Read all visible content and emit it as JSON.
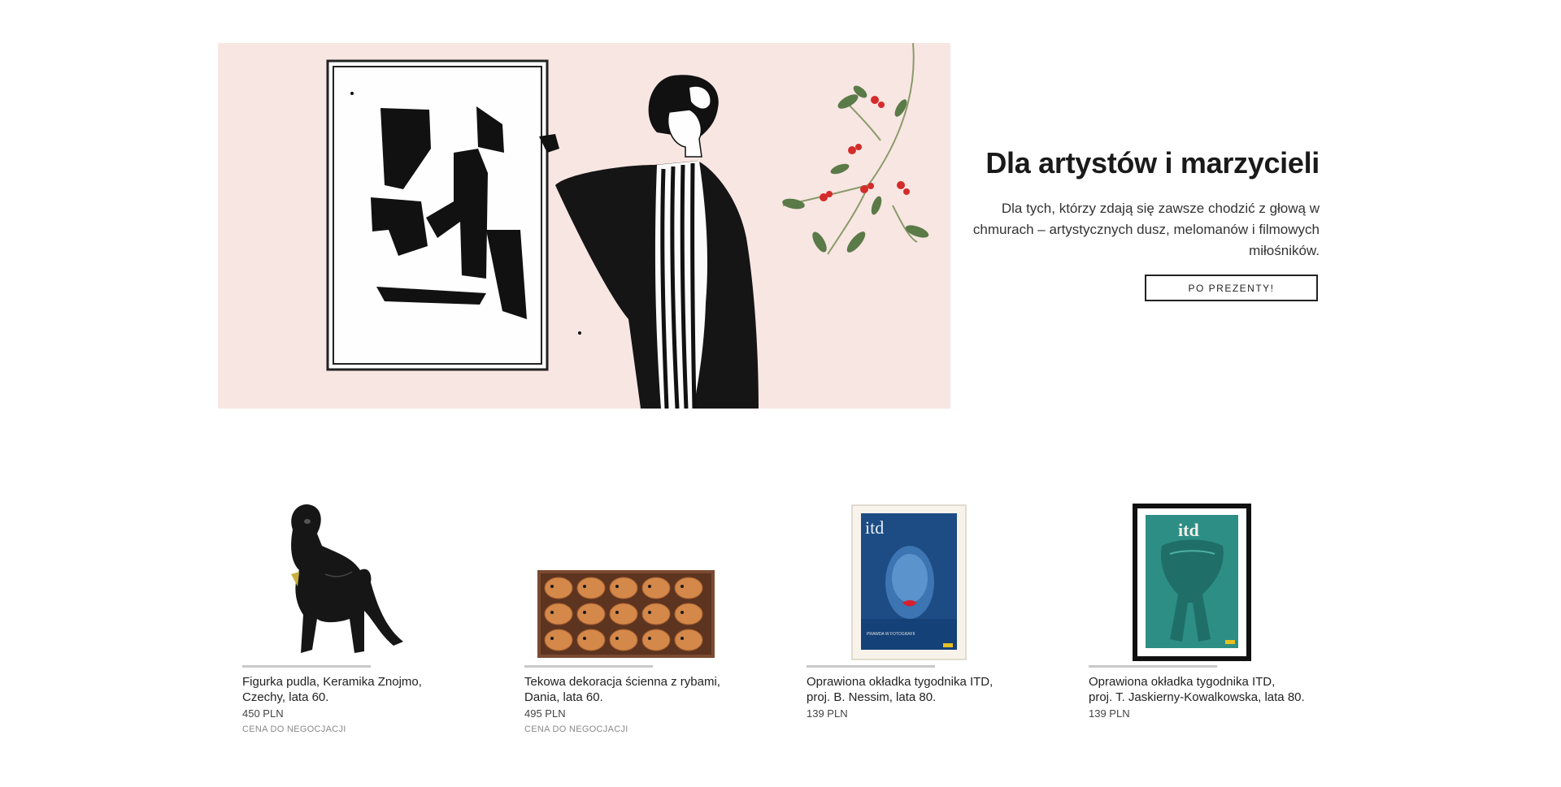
{
  "hero": {
    "title": "Dla artystów i marzycieli",
    "description": "Dla tych, którzy zdają się zawsze chodzić z głową w chmurach – artystycznych dusz, melomanów i filmowych miłośników.",
    "cta_label": "PO PREZENTY!"
  },
  "products": [
    {
      "name": "Figurka pudla, Keramika Znojmo,\nCzechy, lata 60.",
      "price": "450 PLN",
      "note": "CENA DO NEGOCJACJI",
      "image": "black-poodle-figurine"
    },
    {
      "name": "Tekowa dekoracja ścienna z rybami,\nDania, lata 60.",
      "price": "495 PLN",
      "note": "CENA DO NEGOCJACJI",
      "image": "teak-fish-wall-decoration"
    },
    {
      "name": "Oprawiona okładka tygodnika ITD,\nproj. B. Nessim, lata 80.",
      "price": "139 PLN",
      "note": "",
      "image": "itd-cover-blue-face"
    },
    {
      "name": "Oprawiona okładka tygodnika ITD,\nproj. T. Jaskierny-Kowalkowska, lata 80.",
      "price": "139 PLN",
      "note": "",
      "image": "itd-cover-green-figure"
    }
  ],
  "colors": {
    "hero_background": "#f8e6e3",
    "berry_red": "#d42b2b",
    "leaf_green": "#6f8a5a"
  }
}
